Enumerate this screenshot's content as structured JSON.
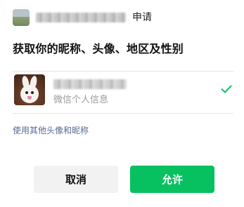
{
  "header": {
    "app_logo_icon": "landscape-app-logo-icon",
    "app_name": "",
    "request_label": "申请"
  },
  "title": "获取你的昵称、头像、地区及性别",
  "profile": {
    "avatar_icon": "bunny-avatar-icon",
    "nickname": "",
    "subtitle": "微信个人信息",
    "selected": true,
    "check_icon": "checkmark-icon"
  },
  "other_profile_link": "使用其他头像和昵称",
  "buttons": {
    "cancel": "取消",
    "allow": "允许"
  },
  "colors": {
    "accent_green": "#07c160",
    "link_blue": "#576b95",
    "check_green": "#07c160"
  }
}
